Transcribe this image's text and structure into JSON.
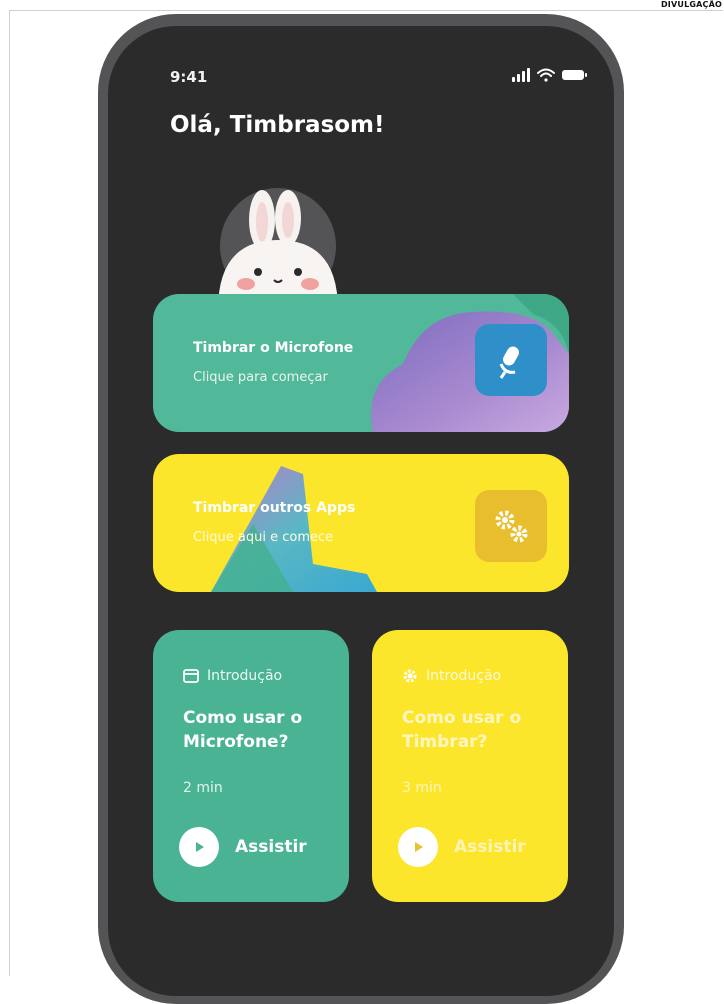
{
  "credit": "DIVULGAÇÃO",
  "status_bar": {
    "time": "9:41"
  },
  "greeting": "Olá, Timbrasom!",
  "cards": [
    {
      "title": "Timbrar o Microfone",
      "subtitle": "Clique para começar",
      "icon": "microphone-icon"
    },
    {
      "title": "Timbrar outros Apps",
      "subtitle": "Clique aqui e comece",
      "icon": "gears-icon"
    }
  ],
  "tutorials": [
    {
      "tag": "Introdução",
      "tag_icon": "window-icon",
      "title": "Como usar o Microfone?",
      "duration": "2 min",
      "action": "Assistir"
    },
    {
      "tag": "Introdução",
      "tag_icon": "gear-icon",
      "title": "Como usar o Timbrar?",
      "duration": "3 min",
      "action": "Assistir"
    }
  ],
  "colors": {
    "green": "#52b89a",
    "yellow": "#fbe62c",
    "screen": "#2b2b2b",
    "frame": "#545456"
  }
}
